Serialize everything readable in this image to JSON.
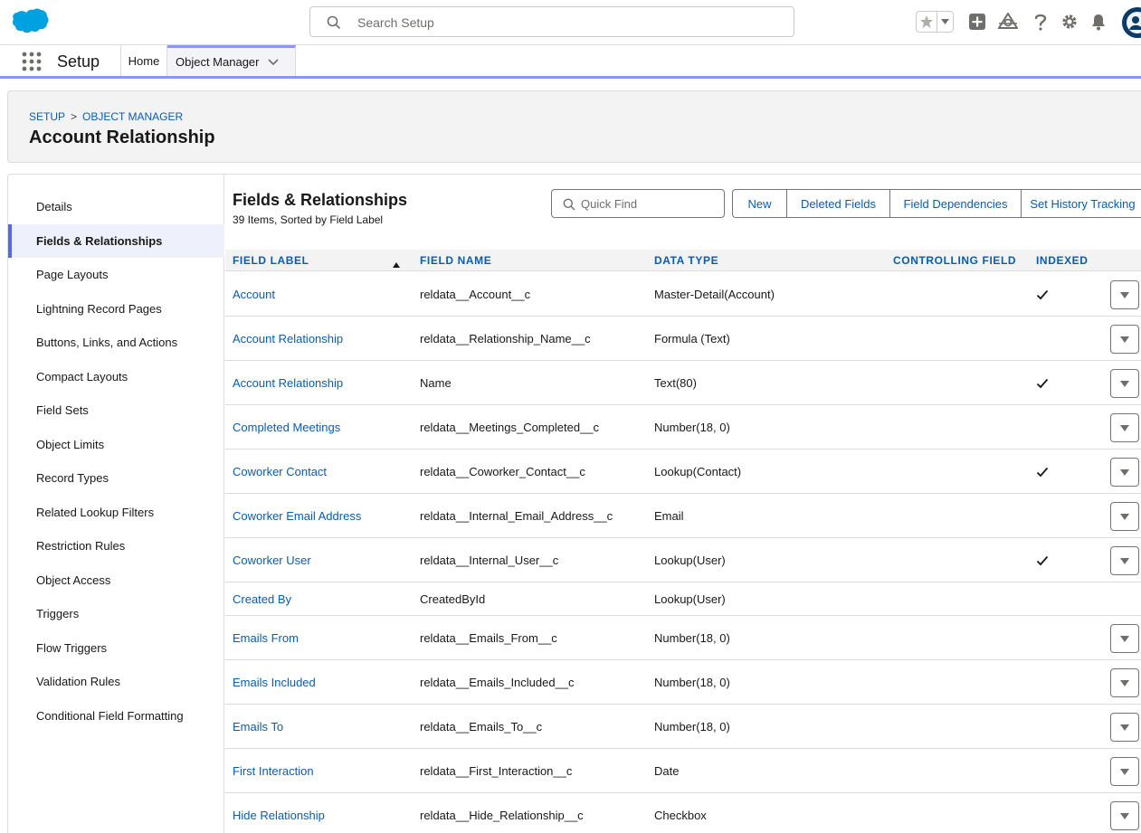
{
  "global_header": {
    "search_placeholder": "Search Setup",
    "icons": [
      "salesforce-cloud-logo",
      "search-icon",
      "favorites-star-icon",
      "chevron-down-icon",
      "add-icon",
      "trailhead-icon",
      "help-icon",
      "gear-icon",
      "bell-icon",
      "avatar"
    ]
  },
  "context_bar": {
    "app_name": "Setup",
    "tabs": [
      {
        "label": "Home"
      },
      {
        "label": "Object Manager"
      }
    ]
  },
  "page_header": {
    "breadcrumb": [
      "SETUP",
      "OBJECT MANAGER"
    ],
    "breadcrumb_separator": ">",
    "title": "Account Relationship"
  },
  "sidebar": {
    "items": [
      {
        "label": "Details"
      },
      {
        "label": "Fields & Relationships",
        "active": true
      },
      {
        "label": "Page Layouts"
      },
      {
        "label": "Lightning Record Pages"
      },
      {
        "label": "Buttons, Links, and Actions"
      },
      {
        "label": "Compact Layouts"
      },
      {
        "label": "Field Sets"
      },
      {
        "label": "Object Limits"
      },
      {
        "label": "Record Types"
      },
      {
        "label": "Related Lookup Filters"
      },
      {
        "label": "Restriction Rules"
      },
      {
        "label": "Object Access"
      },
      {
        "label": "Triggers"
      },
      {
        "label": "Flow Triggers"
      },
      {
        "label": "Validation Rules"
      },
      {
        "label": "Conditional Field Formatting"
      }
    ]
  },
  "main": {
    "title": "Fields & Relationships",
    "subtitle": "39 Items, Sorted by Field Label",
    "quick_find_placeholder": "Quick Find",
    "buttons": [
      "New",
      "Deleted Fields",
      "Field Dependencies",
      "Set History Tracking"
    ],
    "columns": [
      "FIELD LABEL",
      "FIELD NAME",
      "DATA TYPE",
      "CONTROLLING FIELD",
      "INDEXED"
    ],
    "sort_column": "FIELD LABEL",
    "sort_direction": "ascending",
    "rows": [
      {
        "label": "Account",
        "name": "reldata__Account__c",
        "type": "Master-Detail(Account)",
        "controlling": "",
        "indexed": true,
        "menu": true
      },
      {
        "label": "Account Relationship",
        "name": "reldata__Relationship_Name__c",
        "type": "Formula (Text)",
        "controlling": "",
        "indexed": false,
        "menu": true
      },
      {
        "label": "Account Relationship",
        "name": "Name",
        "type": "Text(80)",
        "controlling": "",
        "indexed": true,
        "menu": true
      },
      {
        "label": "Completed Meetings",
        "name": "reldata__Meetings_Completed__c",
        "type": "Number(18, 0)",
        "controlling": "",
        "indexed": false,
        "menu": true
      },
      {
        "label": "Coworker Contact",
        "name": "reldata__Coworker_Contact__c",
        "type": "Lookup(Contact)",
        "controlling": "",
        "indexed": true,
        "menu": true
      },
      {
        "label": "Coworker Email Address",
        "name": "reldata__Internal_Email_Address__c",
        "type": "Email",
        "controlling": "",
        "indexed": false,
        "menu": true
      },
      {
        "label": "Coworker User",
        "name": "reldata__Internal_User__c",
        "type": "Lookup(User)",
        "controlling": "",
        "indexed": true,
        "menu": true
      },
      {
        "label": "Created By",
        "name": "CreatedById",
        "type": "Lookup(User)",
        "controlling": "",
        "indexed": false,
        "menu": false
      },
      {
        "label": "Emails From",
        "name": "reldata__Emails_From__c",
        "type": "Number(18, 0)",
        "controlling": "",
        "indexed": false,
        "menu": true
      },
      {
        "label": "Emails Included",
        "name": "reldata__Emails_Included__c",
        "type": "Number(18, 0)",
        "controlling": "",
        "indexed": false,
        "menu": true
      },
      {
        "label": "Emails To",
        "name": "reldata__Emails_To__c",
        "type": "Number(18, 0)",
        "controlling": "",
        "indexed": false,
        "menu": true
      },
      {
        "label": "First Interaction",
        "name": "reldata__First_Interaction__c",
        "type": "Date",
        "controlling": "",
        "indexed": false,
        "menu": true
      },
      {
        "label": "Hide Relationship",
        "name": "reldata__Hide_Relationship__c",
        "type": "Checkbox",
        "controlling": "",
        "indexed": false,
        "menu": true
      }
    ]
  },
  "colors": {
    "brand_blue": "#0b5cab",
    "salesforce_cloud": "#00a1e0",
    "active_accent": "#8a96ff",
    "border": "#dddbda"
  }
}
